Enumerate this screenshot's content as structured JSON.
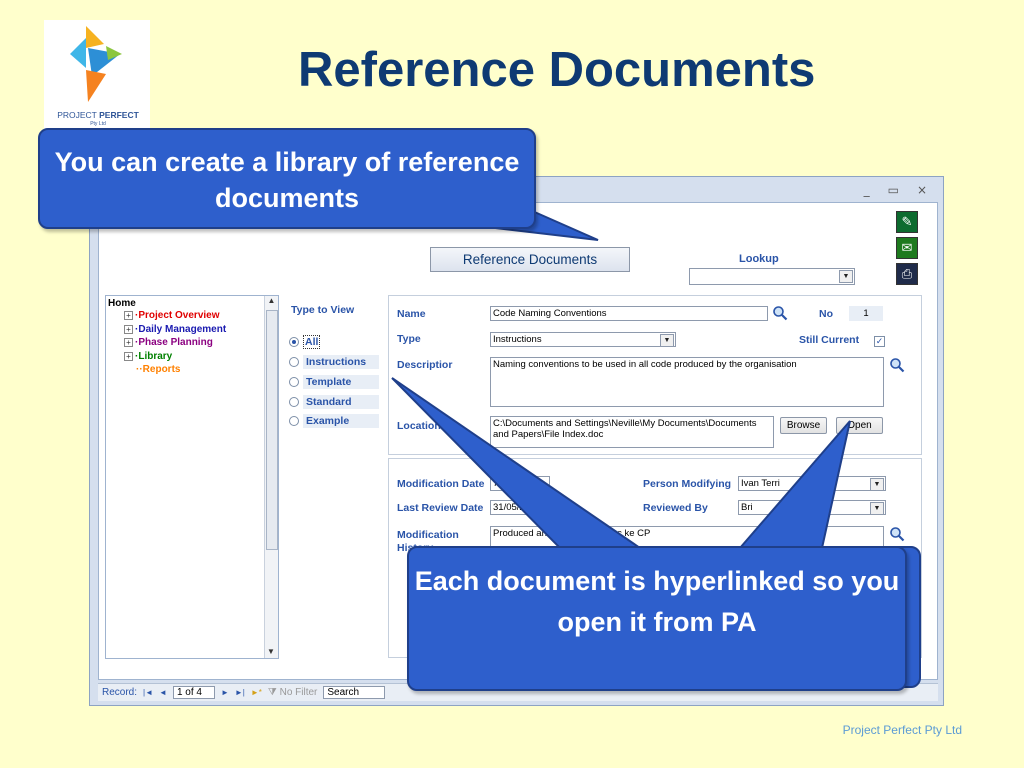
{
  "slide": {
    "title": "Reference Documents",
    "footer": "Project Perfect Pty Ltd"
  },
  "logo": {
    "name_plain": "PROJECT",
    "name_bold": "PERFECT",
    "sub": "Pty Ltd"
  },
  "callouts": {
    "top": "You can create a library of reference documents",
    "bottom": "Each document is hyperlinked so you open it from PA"
  },
  "window": {
    "controls": {
      "minimize": "_",
      "maximize": "▭",
      "close": "×"
    },
    "form_title": "Reference Documents",
    "lookup": {
      "label": "Lookup",
      "value": ""
    },
    "side_icons": [
      "pin-icon",
      "email-icon",
      "print-icon"
    ],
    "tree": {
      "root": "Home",
      "items": [
        {
          "label": "Project Overview",
          "color": "#E00000",
          "expander": "+"
        },
        {
          "label": "Daily Management",
          "color": "#1A1AB0",
          "expander": "+"
        },
        {
          "label": "Phase Planning",
          "color": "#8B0080",
          "expander": "+"
        },
        {
          "label": "Library",
          "color": "#008000",
          "expander": "+"
        },
        {
          "label": "Reports",
          "color": "#FF8000",
          "expander": ""
        }
      ]
    },
    "type_to_view": {
      "label": "Type to View",
      "options": [
        "All",
        "Instructions",
        "Template",
        "Standard",
        "Example"
      ],
      "selected": "All"
    },
    "record": {
      "name_label": "Name",
      "name": "Code Naming Conventions",
      "no_label": "No",
      "no": "1",
      "type_label": "Type",
      "type": "Instructions",
      "still_current_label": "Still Current",
      "still_current": true,
      "description_label": "Descriptior",
      "description": "Naming conventions to be used in all code produced by the organisation",
      "location_label": "Location",
      "location_line1": "C:\\Documents and Settings\\Neville\\My Documents\\Documents",
      "location_line2": "and Papers\\File Index.doc",
      "browse_label": "Browse",
      "open_label": "Open",
      "mod_date_label": "Modification Date",
      "mod_date": "7/05/200",
      "person_modifying_label": "Person Modifying",
      "person_modifying": "Ivan Terri",
      "last_review_label": "Last Review Date",
      "last_review": "31/05/2001",
      "reviewed_by_label": "Reviewed By",
      "reviewed_by": "Bri",
      "history_label_1": "Modification",
      "history_label_2": "History",
      "history": "Produced and reviewed after c                    ke CP"
    },
    "record_bar": {
      "label": "Record:",
      "first": "|◄",
      "prev": "◄",
      "position": "1 of 4",
      "next": "►",
      "last": "►|",
      "new": "►*",
      "filter": "No Filter",
      "search": "Search"
    }
  }
}
